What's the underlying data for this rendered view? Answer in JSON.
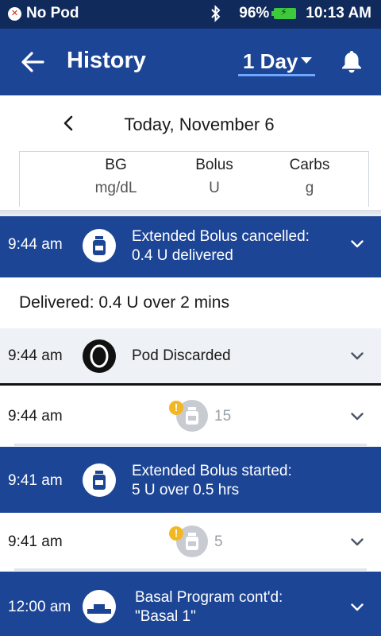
{
  "status_bar": {
    "pod_status": "No Pod",
    "battery": "96%",
    "time": "10:13 AM"
  },
  "app_bar": {
    "title": "History",
    "range": "1 Day"
  },
  "date_nav": {
    "date": "Today, November 6"
  },
  "columns": [
    {
      "name": "BG",
      "unit": "mg/dL"
    },
    {
      "name": "Bolus",
      "unit": "U"
    },
    {
      "name": "Carbs",
      "unit": "g"
    }
  ],
  "events": [
    {
      "time": "9:44 am",
      "line1": "Extended Bolus cancelled:",
      "line2": "0.4 U delivered",
      "icon": "insulin-vial-icon"
    },
    {
      "detail": "Delivered: 0.4 U over 2 mins"
    },
    {
      "time": "9:44 am",
      "line1": "Pod Discarded",
      "icon": "pod-icon"
    },
    {
      "time": "9:44 am",
      "value": "15",
      "icon": "bolus-warning-icon"
    },
    {
      "time": "9:41 am",
      "line1": "Extended Bolus started:",
      "line2": "5 U over 0.5 hrs",
      "icon": "insulin-vial-icon"
    },
    {
      "time": "9:41 am",
      "value": "5",
      "icon": "bolus-warning-icon"
    },
    {
      "time": "12:00 am",
      "line1": "Basal Program cont'd:",
      "line2": "\"Basal 1\"",
      "icon": "basal-program-icon"
    }
  ],
  "colors": {
    "status_bar": "#102a5c",
    "primary_blue": "#1d4596",
    "row_gray": "#eef1f5",
    "warning": "#f2b824"
  }
}
